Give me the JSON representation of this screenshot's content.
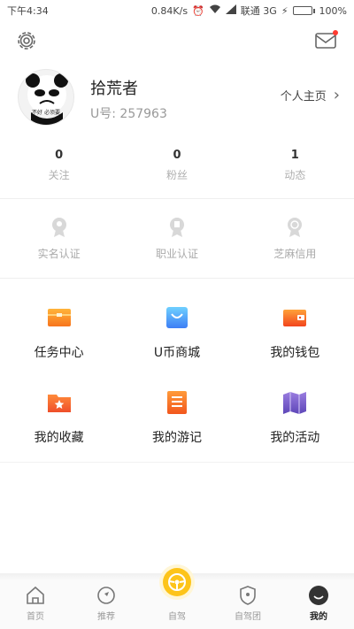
{
  "statusbar": {
    "time": "下午4:34",
    "network_speed": "0.84K/s",
    "carrier": "联通 3G",
    "battery": "100%",
    "battery_level": 1.0
  },
  "topbar": {
    "settings_icon": "gear-icon",
    "mail_icon": "envelope-icon",
    "mail_has_unread": true
  },
  "profile": {
    "username": "拾荒者",
    "uid": "U号: 257963",
    "homepage_label": "个人主页",
    "avatar_caption": "不好 必须要"
  },
  "stats": [
    {
      "value": "0",
      "label": "关注"
    },
    {
      "value": "0",
      "label": "粉丝"
    },
    {
      "value": "1",
      "label": "动态"
    }
  ],
  "verify": [
    {
      "label": "实名认证",
      "icon": "realname-verify-icon"
    },
    {
      "label": "职业认证",
      "icon": "career-verify-icon"
    },
    {
      "label": "芝麻信用",
      "icon": "sesame-credit-icon"
    }
  ],
  "features": [
    {
      "label": "任务中心",
      "icon": "task-center-icon",
      "color": "#f7941d"
    },
    {
      "label": "U币商城",
      "icon": "shopping-bag-icon",
      "color": "#3da9f5"
    },
    {
      "label": "我的钱包",
      "icon": "wallet-icon",
      "color": "#f26a2a"
    },
    {
      "label": "我的收藏",
      "icon": "favorites-folder-icon",
      "color": "#f26a2a"
    },
    {
      "label": "我的游记",
      "icon": "travel-notes-icon",
      "color": "#f26a2a"
    },
    {
      "label": "我的活动",
      "icon": "activity-map-icon",
      "color": "#7c5cc4"
    }
  ],
  "nav": [
    {
      "label": "首页",
      "icon": "home-icon",
      "active": false
    },
    {
      "label": "推荐",
      "icon": "compass-icon",
      "active": false
    },
    {
      "label": "自驾",
      "icon": "steering-wheel-icon",
      "active": false
    },
    {
      "label": "自驾团",
      "icon": "shield-icon",
      "active": false
    },
    {
      "label": "我的",
      "icon": "profile-face-icon",
      "active": true
    }
  ],
  "colors": {
    "accent_yellow": "#fdc41a",
    "muted_text": "#aaaaaa",
    "notification_red": "#ff3b30"
  }
}
